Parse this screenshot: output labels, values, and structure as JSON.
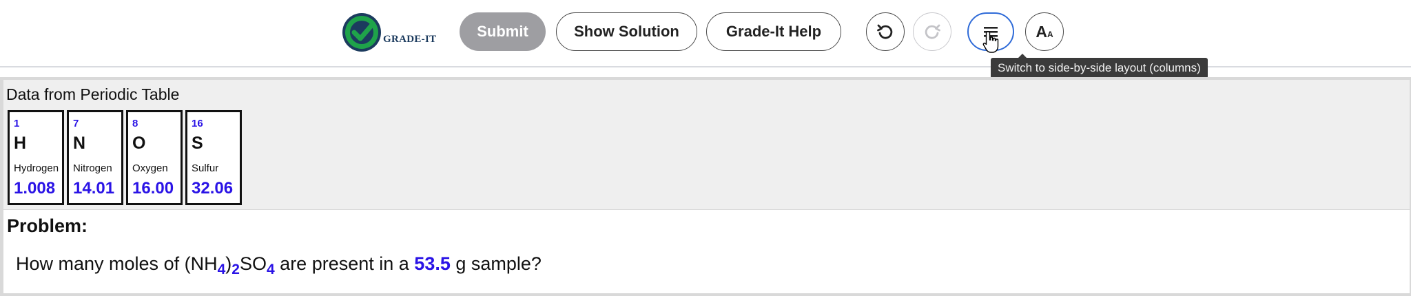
{
  "toolbar": {
    "logo_text": "GRADE-IT",
    "submit_label": "Submit",
    "show_solution_label": "Show Solution",
    "help_label": "Grade-It Help",
    "font_size_label": "A",
    "font_size_small": "A",
    "tooltip": "Switch to side-by-side layout (columns)"
  },
  "periodic": {
    "title": "Data from Periodic Table",
    "elements": [
      {
        "number": "1",
        "symbol": "H",
        "name": "Hydrogen",
        "mass": "1.008"
      },
      {
        "number": "7",
        "symbol": "N",
        "name": "Nitrogen",
        "mass": "14.01"
      },
      {
        "number": "8",
        "symbol": "O",
        "name": "Oxygen",
        "mass": "16.00"
      },
      {
        "number": "16",
        "symbol": "S",
        "name": "Sulfur",
        "mass": "32.06"
      }
    ]
  },
  "problem": {
    "label": "Problem:",
    "text_pre": "How many moles of ",
    "formula": {
      "p1": "(NH",
      "sub1": "4",
      "p2": ")",
      "sub2": "2",
      "p3": "SO",
      "sub3": "4"
    },
    "text_mid": " are present in a ",
    "value": "53.5",
    "text_post": " g sample?"
  },
  "colors": {
    "accent_blue": "#2a13e6",
    "layout_button_ring": "#2f6bd8",
    "submit_disabled": "#9e9ea2",
    "logo_green": "#1fa34a",
    "logo_navy": "#1c3b5e"
  }
}
